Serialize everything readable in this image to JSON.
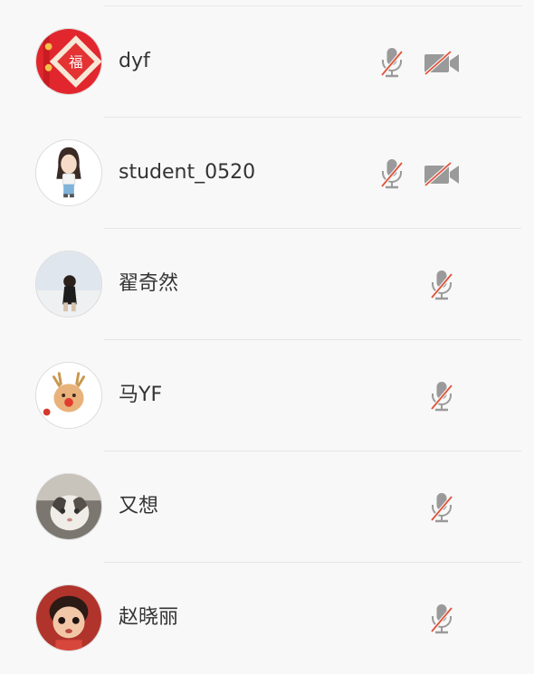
{
  "participants": [
    {
      "name": "dyf",
      "mic": "muted",
      "camera": "off",
      "avatar": "fu-charm-avatar"
    },
    {
      "name": "student_0520",
      "mic": "muted",
      "camera": "off",
      "avatar": "cartoon-girl-avatar"
    },
    {
      "name": "翟奇然",
      "mic": "muted",
      "avatar": "photo-girl-avatar"
    },
    {
      "name": "马YF",
      "mic": "muted",
      "avatar": "reindeer-avatar"
    },
    {
      "name": "又想",
      "mic": "muted",
      "avatar": "cat-photo-avatar"
    },
    {
      "name": "赵晓丽",
      "mic": "muted",
      "avatar": "cartoon-child-avatar"
    }
  ],
  "colors": {
    "icon_gray": "#9a9a9a",
    "slash_red": "#e0533b",
    "text": "#333333",
    "divider": "#e6e6e6"
  }
}
